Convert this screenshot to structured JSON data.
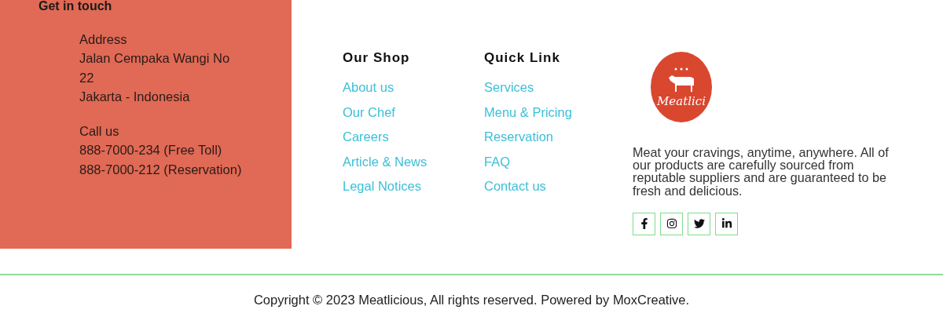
{
  "contact": {
    "title": "Get in touch",
    "groups": [
      {
        "lines": [
          "Address",
          "Jalan Cempaka Wangi No",
          "22",
          "Jakarta - Indonesia"
        ]
      },
      {
        "lines": [
          "Call us",
          "888-7000-234 (Free Toll)",
          "888-7000-212 (Reservation)"
        ]
      }
    ]
  },
  "columns": [
    {
      "title": "Our Shop",
      "links": [
        "About us",
        "Our Chef",
        "Careers",
        "Article & News",
        "Legal Notices"
      ]
    },
    {
      "title": "Quick Link",
      "links": [
        "Services",
        "Menu & Pricing",
        "Reservation",
        "FAQ",
        "Contact us"
      ]
    }
  ],
  "brand": {
    "logo_text": "Meatlici",
    "description": "Meat your cravings, anytime, anywhere. All of our products are carefully sourced from reputable suppliers and are guaranteed to be fresh and delicious.",
    "social": [
      {
        "kind": "facebook"
      },
      {
        "kind": "instagram"
      },
      {
        "kind": "twitter"
      },
      {
        "kind": "linkedin"
      }
    ]
  },
  "copyright": "Copyright © 2023 Meatlicious, All rights reserved. Powered by MoxCreative."
}
